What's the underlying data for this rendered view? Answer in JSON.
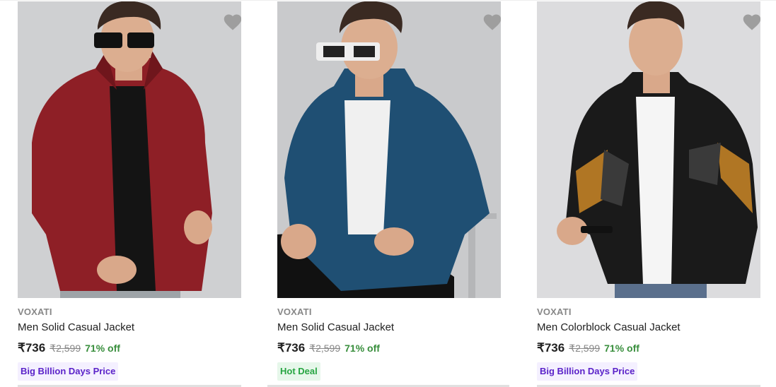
{
  "products": [
    {
      "brand": "VOXATI",
      "title": "Men Solid Casual Jacket",
      "price": "₹736",
      "mrp": "₹2,599",
      "discount": "71% off",
      "badge": "Big Billion Days Price",
      "badge_type": "bbd",
      "jacket_color": "#8e1f26",
      "bg_color": "#cfd0d2",
      "icon": "heart-icon"
    },
    {
      "brand": "VOXATI",
      "title": "Men Solid Casual Jacket",
      "price": "₹736",
      "mrp": "₹2,599",
      "discount": "71% off",
      "badge": "Hot Deal",
      "badge_type": "hot",
      "jacket_color": "#1f4f73",
      "bg_color": "#c9cacc",
      "icon": "heart-icon"
    },
    {
      "brand": "VOXATI",
      "title": "Men Colorblock Casual Jacket",
      "price": "₹736",
      "mrp": "₹2,599",
      "discount": "71% off",
      "badge": "Big Billion Days Price",
      "badge_type": "bbd",
      "jacket_color": "#1a1a1a",
      "bg_color": "#dcdcde",
      "icon": "heart-icon"
    }
  ],
  "colors": {
    "discount": "#388e3c",
    "bbd_text": "#5a22c9",
    "hot_text": "#26a541",
    "heart": "#9e9e9e"
  }
}
